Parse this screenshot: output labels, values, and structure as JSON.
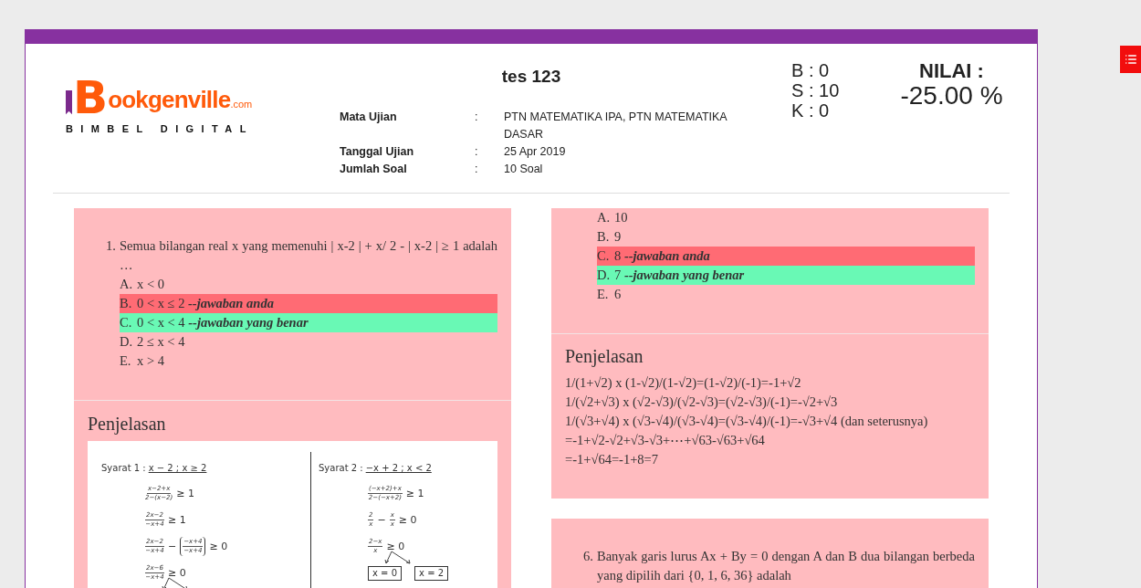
{
  "header": {
    "logo": {
      "mark": "B",
      "name": "ookgenville",
      "domain": ".com",
      "tagline": "BIMBEL DIGITAL"
    },
    "title": "tes 123",
    "info": [
      {
        "label": "Mata Ujian",
        "separator": ":",
        "value": "PTN MATEMATIKA IPA, PTN MATEMATIKA DASAR"
      },
      {
        "label": "Tanggal Ujian",
        "separator": ":",
        "value": "25 Apr 2019"
      },
      {
        "label": "Jumlah Soal",
        "separator": ":",
        "value": "10 Soal"
      }
    ],
    "counts": [
      "B : 0",
      "S : 10",
      "K : 0"
    ],
    "score": {
      "label": "NILAI :",
      "value": "-25.00 %"
    }
  },
  "columns": [
    [
      {
        "number": "1.",
        "question": "Semua bilangan real x yang memenuhi | x-2 | + x/ 2 - | x-2 | ≥ 1 adalah …",
        "options": [
          {
            "letter": "A.",
            "text": "x < 0",
            "selected": false,
            "correct": false
          },
          {
            "letter": "B.",
            "text": "0 < x ≤ 2",
            "note": "--jawaban anda",
            "selected": true,
            "correct": false
          },
          {
            "letter": "C.",
            "text": "0 < x < 4",
            "note": "--jawaban yang benar",
            "selected": false,
            "correct": true
          },
          {
            "letter": "D.",
            "text": "2 ≤ x < 4",
            "selected": false,
            "correct": false
          },
          {
            "letter": "E.",
            "text": "x > 4",
            "selected": false,
            "correct": false
          }
        ],
        "explanation": {
          "title": "Penjelasan",
          "kind": "figure",
          "figure": [
            {
              "label": "Syarat  1 :",
              "condition": "x − 2 ; x ≥ 2",
              "lines": [
                {
                  "terms": [
                    {
                      "kind": "frac",
                      "num": "x−2+x",
                      "den": "2−(x−2)"
                    },
                    {
                      "kind": "text",
                      "text": "≥ 1"
                    }
                  ]
                },
                {
                  "terms": [
                    {
                      "kind": "frac",
                      "num": "2x−2",
                      "den": "−x+4"
                    },
                    {
                      "kind": "text",
                      "text": "≥ 1"
                    }
                  ]
                },
                {
                  "terms": [
                    {
                      "kind": "frac",
                      "num": "2x−2",
                      "den": "−x+4"
                    },
                    {
                      "kind": "text",
                      "text": "−"
                    },
                    {
                      "kind": "paren",
                      "num": "−x+4",
                      "den": "−x+4"
                    },
                    {
                      "kind": "text",
                      "text": "≥ 0"
                    }
                  ]
                },
                {
                  "terms": [
                    {
                      "kind": "frac",
                      "num": "2x−6",
                      "den": "−x+4"
                    },
                    {
                      "kind": "text",
                      "text": "≥ 0"
                    }
                  ],
                  "branches": true
                }
              ]
            },
            {
              "label": "Syarat  2 :",
              "condition": "−x + 2 ; x < 2",
              "lines": [
                {
                  "terms": [
                    {
                      "kind": "frac",
                      "num": "(−x+2)+x",
                      "den": "2−(−x+2)"
                    },
                    {
                      "kind": "text",
                      "text": "≥ 1"
                    }
                  ]
                },
                {
                  "terms": [
                    {
                      "kind": "frac",
                      "num": "2",
                      "den": "x"
                    },
                    {
                      "kind": "text",
                      "text": "−"
                    },
                    {
                      "kind": "frac",
                      "num": "x",
                      "den": "x"
                    },
                    {
                      "kind": "text",
                      "text": "≥ 0"
                    }
                  ]
                },
                {
                  "terms": [
                    {
                      "kind": "frac",
                      "num": "2−x",
                      "den": "x"
                    },
                    {
                      "kind": "text",
                      "text": "≥ 0"
                    }
                  ],
                  "branches": true
                },
                {
                  "terms": [
                    {
                      "kind": "box",
                      "text": "x = 0"
                    },
                    {
                      "kind": "box",
                      "text": "x = 2"
                    }
                  ]
                }
              ]
            }
          ]
        }
      }
    ],
    [
      {
        "options": [
          {
            "letter": "A.",
            "text": "10",
            "selected": false,
            "correct": false
          },
          {
            "letter": "B.",
            "text": "9",
            "selected": false,
            "correct": false
          },
          {
            "letter": "C.",
            "text": "8",
            "note": "--jawaban anda",
            "selected": true,
            "correct": false
          },
          {
            "letter": "D.",
            "text": "7",
            "note": "--jawaban yang benar",
            "selected": false,
            "correct": true
          },
          {
            "letter": "E.",
            "text": "6",
            "selected": false,
            "correct": false
          }
        ],
        "explanation": {
          "title": "Penjelasan",
          "kind": "text",
          "lines": [
            "1/(1+√2) x (1-√2)/(1-√2)=(1-√2)/(-1)=-1+√2",
            "1/(√2+√3) x (√2-√3)/(√2-√3)=(√2-√3)/(-1)=-√2+√3",
            "1/(√3+√4) x (√3-√4)/(√3-√4)=(√3-√4)/(-1)=-√3+√4 (dan seterusnya)",
            "=-1+√2-√2+√3-√3+⋯+√63-√63+√64",
            "=-1+√64=-1+8=7"
          ]
        }
      },
      {
        "number": "6.",
        "question": "Banyak garis lurus Ax + By = 0 dengan A dan B dua bilangan berbeda yang dipilih dari {0, 1, 6, 36} adalah"
      }
    ]
  ]
}
